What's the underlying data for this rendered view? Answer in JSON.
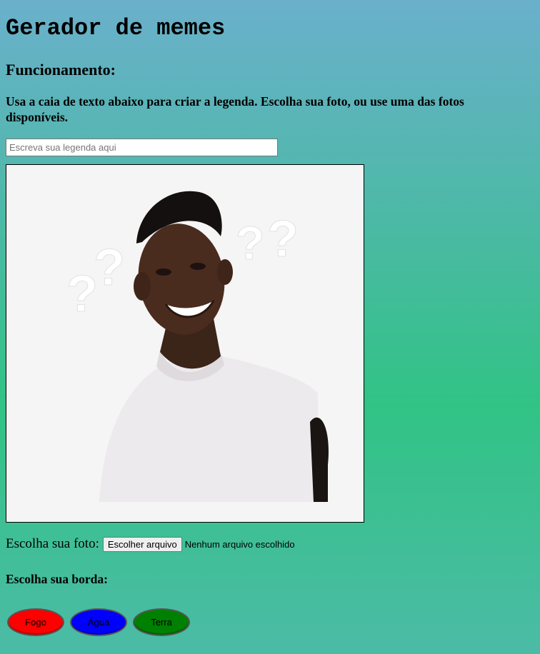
{
  "header": {
    "title": "Gerador de memes",
    "subtitle": "Funcionamento:",
    "instructions": "Usa a caia de texto abaixo para criar a legenda. Escolha sua foto, ou use uma das fotos disponíveis."
  },
  "caption": {
    "placeholder": "Escreva sua legenda aqui",
    "value": ""
  },
  "meme": {
    "image_description_icon": "confused-man-photo"
  },
  "file_picker": {
    "label": "Escolha sua foto:",
    "button_label": "Escolher arquivo",
    "status": "Nenhum arquivo escolhido"
  },
  "borders": {
    "heading": "Escolha sua borda:",
    "options": [
      {
        "label": "Fogo",
        "color": "#ff0000"
      },
      {
        "label": "Água",
        "color": "#0000ff"
      },
      {
        "label": "Terra",
        "color": "#008000"
      }
    ]
  },
  "colors": {
    "background_top": "#6ab0cc",
    "background_mid": "#31c385",
    "frame_bg": "#f6f5f5"
  }
}
